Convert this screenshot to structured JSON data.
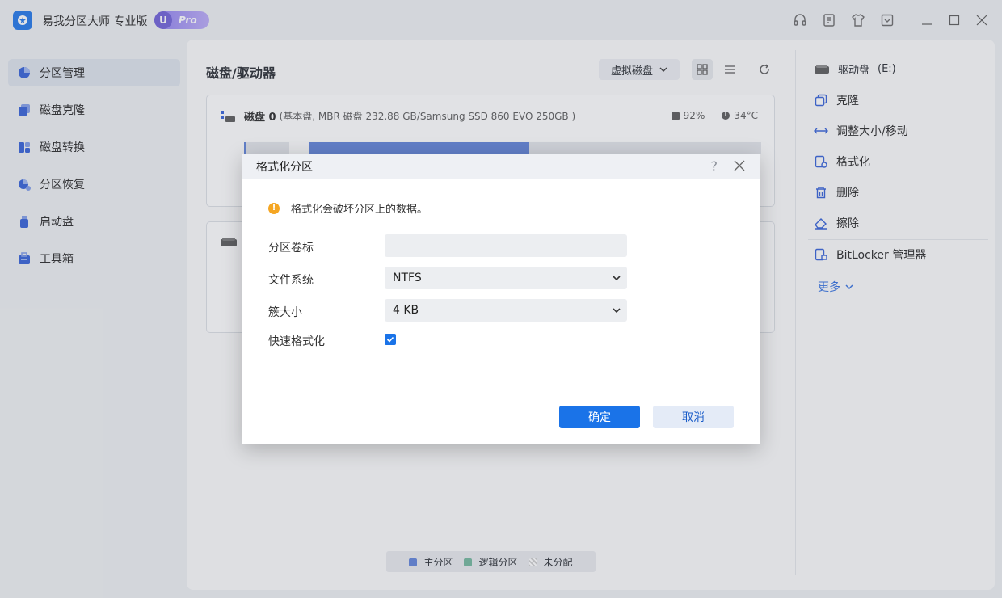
{
  "app": {
    "title": "易我分区大师 专业版",
    "badge_letter": "U",
    "badge_text": "Pro"
  },
  "sidebar": {
    "items": [
      {
        "label": "分区管理",
        "icon": "pie-chart-icon",
        "active": true
      },
      {
        "label": "磁盘克隆",
        "icon": "clone-icon"
      },
      {
        "label": "磁盘转换",
        "icon": "convert-icon"
      },
      {
        "label": "分区恢复",
        "icon": "recover-icon"
      },
      {
        "label": "启动盘",
        "icon": "usb-icon"
      },
      {
        "label": "工具箱",
        "icon": "toolbox-icon"
      }
    ]
  },
  "main": {
    "title": "磁盘/驱动器",
    "virtual_disk_label": "虚拟磁盘",
    "disk0": {
      "name": "磁盘 0",
      "info": "(基本盘, MBR 磁盘 232.88 GB/Samsung SSD 860 EVO 250GB )",
      "health": "92%",
      "temp": "34°C"
    },
    "legend": {
      "primary": "主分区",
      "logical": "逻辑分区",
      "unallocated": "未分配",
      "primary_color": "#5b7fd9",
      "logical_color": "#6fb59a"
    }
  },
  "right_panel": {
    "drive_label": "驱动盘",
    "drive_letter": "(E:)",
    "actions": [
      "克隆",
      "调整大小/移动",
      "格式化",
      "删除",
      "擦除"
    ],
    "bitlocker": "BitLocker 管理器",
    "more": "更多"
  },
  "dialog": {
    "title": "格式化分区",
    "help": "?",
    "warning": "格式化会破坏分区上的数据。",
    "volume_label": "分区卷标",
    "volume_value": "",
    "fs_label": "文件系统",
    "fs_value": "NTFS",
    "cluster_label": "簇大小",
    "cluster_value": "4 KB",
    "quick_label": "快速格式化",
    "quick_checked": true,
    "ok": "确定",
    "cancel": "取消"
  },
  "colors": {
    "accent": "#1a73e8",
    "warning": "#f5a623"
  }
}
